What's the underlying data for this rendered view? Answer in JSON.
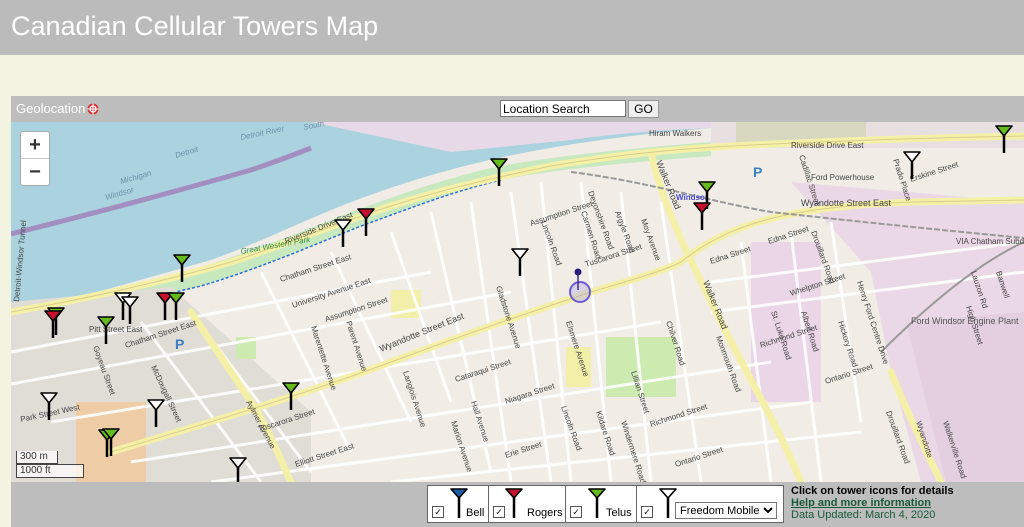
{
  "header": {
    "title": "Canadian Cellular Towers Map"
  },
  "toolbar": {
    "geolocation_label": "Geolocation",
    "search_value": "Location Search",
    "go_label": "GO"
  },
  "map": {
    "zoom_in": "+",
    "zoom_out": "−",
    "scale_metric": "300 m",
    "scale_imperial": "1000 ft",
    "labels": {
      "detroit_river": "Detroit River",
      "south": "South",
      "michigan": "Michigan",
      "detroit": "Detroit",
      "windsor_water": "Windsor",
      "hiram_walkers": "Hiram Walkers",
      "riverside_drive_east_top": "Riverside Drive East",
      "riverside_drive_east_west": "Riverside Drive East",
      "detroit_windsor_tunnel": "Detroit-Windsor Tunnel",
      "great_western_park": "Great Western Park",
      "wyandotte_street_east": "Wyandotte Street East",
      "wyandotte_street_east_right": "Wyandotte Street East",
      "walker_road_top": "Walker Road",
      "walker_road_bottom": "Walker Road",
      "windsor_station": "Windsor",
      "ford_powerhouse": "Ford Powerhouse",
      "ford_windsor_engine_plant": "Ford Windsor Engine Plant",
      "via_chatham": "VIA Chatham Subdi",
      "chatham_street_east": "Chatham Street East",
      "chatham_street_east_2": "Chatham Street East",
      "university_avenue_east": "University Avenue East",
      "assumption_street": "Assumption Street",
      "assumption_street_2": "Assumption Street",
      "pitt_street_east": "Pitt Street East",
      "aylmer_avenue": "Aylmer Avenue",
      "mcdougall_street": "McDougall Street",
      "goyeau_street": "Goyeau Street",
      "tuscarora_street": "Tuscarora Street",
      "tuscarora_street_2": "Tuscarora Street",
      "elliott_street_east": "Elliott Street East",
      "park_street_west": "Park Street West",
      "cataraqui_street": "Cataraqui Street",
      "niagara_street": "Niagara Street",
      "erie_street": "Erie Street",
      "ontario_street": "Ontario Street",
      "ontario_street_2": "Ontario Street",
      "richmond_street": "Richmond Street",
      "richmond_street_2": "Richmond Street",
      "edna_street": "Edna Street",
      "edna_street_2": "Edna Street",
      "whelpton_street": "Whelpton Street",
      "erskine_street": "Erskine Street",
      "drouillard_road": "Drouillard Road",
      "drouillard_road_2": "Drouillard Road",
      "gladstone_avenue": "Gladstone Avenue",
      "parent_avenue": "Parent Avenue",
      "langlois_avenue": "Langlois Avenue",
      "lincoln_road": "Lincoln Road",
      "lincoln_road_2": "Lincoln Road",
      "devonshire_road": "Devonshire Road",
      "argyle_road": "Argyle Road",
      "moy_avenue": "Moy Avenue",
      "monmouth_road": "Monmouth Road",
      "henry_ford_centre_drive": "Henry Ford Centre Drive",
      "hickory_road": "Hickory Road",
      "albert_road": "Albert Road",
      "st_luke_road": "St. Luke Road",
      "marion_avenue": "Marion Avenue",
      "elsmere_avenue": "Elsmere Avenue",
      "wyandotte_small": "Wyandotte",
      "walkerville_road": "Walkerville Road",
      "marentette_avenue": "Marentette Avenue",
      "lillian_street": "Lillian Street",
      "chilver_road": "Chilver Road",
      "kildare_road": "Kildare Road",
      "carmen_road": "Carmen Road",
      "high_street": "High Street",
      "lauzon_rd": "Lauzon Rd",
      "prado_place": "Prado Place",
      "cadillac_street": "Cadillac Street",
      "banwell": "Banwell",
      "hall_avenue": "Hall Avenue",
      "windermere_road": "Windermere Road",
      "parking": "P"
    }
  },
  "legend": {
    "bell": "Bell",
    "rogers": "Rogers",
    "telus": "Telus",
    "freedom_option": "Freedom Mobile",
    "checkmark": "✓",
    "colors": {
      "bell": "#1a5fa8",
      "rogers": "#c8102e",
      "telus": "#66bb1c",
      "freedom": "#ffffff"
    }
  },
  "info": {
    "click_hint": "Click on tower icons for details",
    "help_link": "Help and more information",
    "data_updated": "Data Updated: March 4, 2020"
  }
}
